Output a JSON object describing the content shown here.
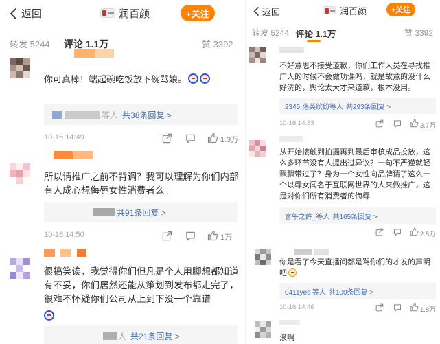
{
  "left": {
    "header": {
      "back_label": "返回",
      "brand": "润百颜",
      "follow_label": "+关注"
    },
    "tabs": {
      "repost": "转发 5244",
      "comment": "评论 1.1万",
      "like": "赞 3392"
    },
    "comments": [
      {
        "text": "你可真棒！端起碗吃饭放下碗骂娘。",
        "reply_user": "等人",
        "reply_count": "共38条回复 >",
        "time": "10-16 14:49",
        "likes": "1.3万"
      },
      {
        "text": "所以请推广之前不背调？我可以理解为你们内部有人成心想侮辱女性消费者么。",
        "reply_user": "",
        "reply_count": "共91条回复 >",
        "time": "10-16 14:50",
        "likes": "1万"
      },
      {
        "text": "很搞笑诶，我觉得你们但凡是个人用脚想都知道有不妥，你们居然还能从策划到发布都走完了，很难不怀疑你们公司从上到下没一个靠谱",
        "reply_user": "人",
        "reply_count": "共21条回复 >",
        "time": "",
        "likes": ""
      }
    ]
  },
  "right": {
    "header": {
      "back_label": "返回",
      "brand": "润百颜",
      "follow_label": "+关注"
    },
    "tabs": {
      "repost": "转发 5244",
      "comment": "评论 1.1万",
      "like": "赞 3392"
    },
    "comments": [
      {
        "text": "不好意思不接受道歉，你们工作人员在寻找推广人的时候不会做功课吗，就是故意的没什么好洗的，舆论太大才来道歉，根本没用。",
        "reply_user": "2345 落英缤纷等人",
        "reply_count": "共293条回复 >",
        "time": "10-16 14:53",
        "likes": "3.7万"
      },
      {
        "text": "从开始接触到拍摄再到最后审核成品投放，这么多环节没有人提出过异议？一句不严谨就轻飘飘带过了？身为一个女性向品牌请了这么一个以辱女闻名于互联网世界的人来做推广，这是对你们所有消费者的侮辱",
        "reply_user": "言午之許_等人",
        "reply_count": "共165条回复 >",
        "time": "",
        "likes": "2.5万"
      },
      {
        "text": "你是看了今天直播间都是骂你们的才发的声明吧",
        "reply_user": "0411yes 等人",
        "reply_count": "共100条回复 >",
        "time": "10-16 14:46",
        "likes": "1.8万"
      },
      {
        "text": "滚啊"
      }
    ]
  },
  "colors": {
    "accent": "#ff8200",
    "link": "#4570b5",
    "muted": "#aaaaaa",
    "reply_bg": "#f5f5f5"
  },
  "icons": [
    "back-chevron-icon",
    "brand-logo-icon",
    "share-icon",
    "comment-icon",
    "like-icon",
    "emoji-icon"
  ]
}
